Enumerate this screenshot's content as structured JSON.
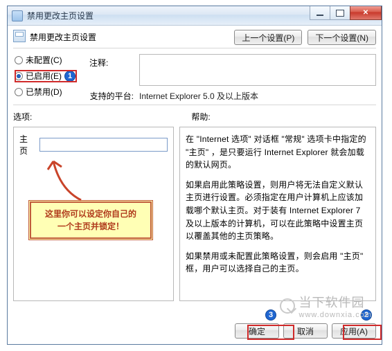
{
  "window": {
    "title": "禁用更改主页设置"
  },
  "header": {
    "title": "禁用更改主页设置",
    "prev_btn": "上一个设置(P)",
    "next_btn": "下一个设置(N)"
  },
  "radios": {
    "not_configured": "未配置(C)",
    "enabled": "已启用(E)",
    "disabled": "已禁用(D)",
    "selected": "enabled"
  },
  "comment": {
    "label": "注释:",
    "value": ""
  },
  "platform": {
    "label": "支持的平台:",
    "value": "Internet Explorer 5.0 及以上版本"
  },
  "section": {
    "options": "选项:",
    "help": "帮助:"
  },
  "homepage": {
    "label": "主页",
    "value": ""
  },
  "help_text": {
    "p1": "在 \"Internet 选项\" 对话框 \"常规\" 选项卡中指定的 \"主页\" ，是只要运行 Internet Explorer 就会加载的默认网页。",
    "p2": "如果启用此策略设置，则用户将无法自定义默认主页进行设置。必须指定在用户计算机上应该加载哪个默认主页。对于装有 Internet Explorer 7 及以上版本的计算机，可以在此策略中设置主页以覆盖其他的主页策略。",
    "p3": "如果禁用或未配置此策略设置，则会启用 \"主页\" 框，用户可以选择自己的主页。"
  },
  "callout": {
    "line1": "这里你可以设定你自己的",
    "line2": "一个主页并锁定！"
  },
  "badges": {
    "b1": "1",
    "b2": "2",
    "b3": "3"
  },
  "footer": {
    "ok": "确定",
    "cancel": "取消",
    "apply": "应用(A)"
  },
  "watermark": {
    "text": "当下软件园",
    "url": "www.downxia.com"
  }
}
